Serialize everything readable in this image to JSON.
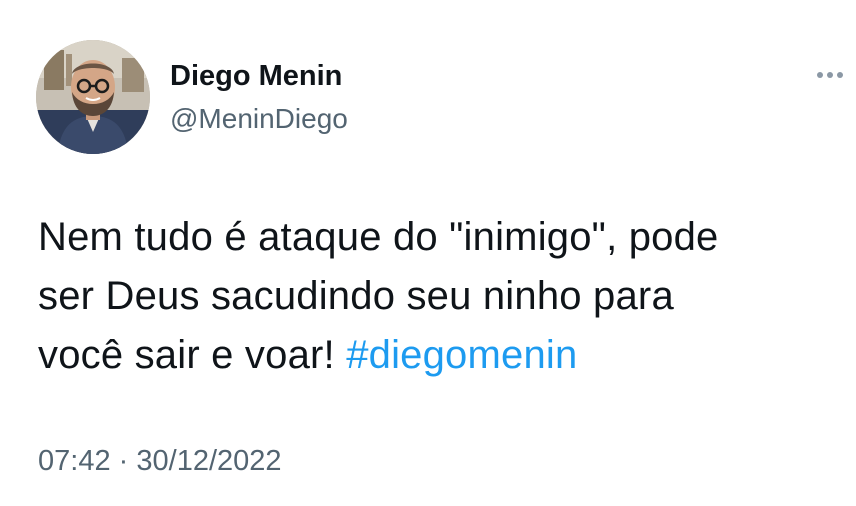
{
  "author": {
    "display_name": "Diego Menin",
    "handle": "@MeninDiego",
    "avatar_icon": "profile-photo"
  },
  "tweet": {
    "text_line1": "Nem tudo é ataque do \"inimigo\", pode",
    "text_line2": "ser Deus sacudindo seu ninho para",
    "text_line3_prefix": "você sair e voar!",
    "hashtag": "#diegomenin",
    "time": "07:42",
    "separator": "·",
    "date": "30/12/2022"
  },
  "icons": {
    "more": "more-options-icon"
  },
  "colors": {
    "hashtag": "#1d9bf0",
    "secondary_text": "#536471",
    "primary_text": "#0f1419"
  }
}
